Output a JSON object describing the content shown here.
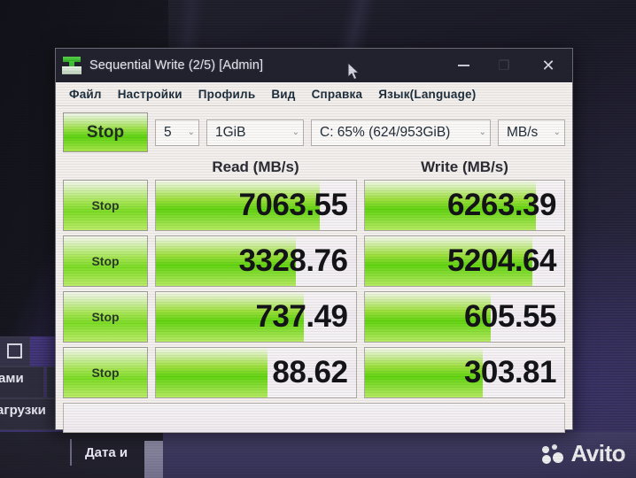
{
  "window": {
    "title": "Sequential Write (2/5) [Admin]",
    "app_icon": "crystaldiskmark-icon",
    "minimize_label": "–",
    "maximize_label": "❐",
    "close_label": "✕"
  },
  "menu": {
    "items": [
      {
        "label": "Файл"
      },
      {
        "label": "Настройки"
      },
      {
        "label": "Профиль"
      },
      {
        "label": "Вид"
      },
      {
        "label": "Справка"
      },
      {
        "label": "Язык(Language)"
      }
    ]
  },
  "toolbar": {
    "all_button_label": "Stop",
    "run_count": "5",
    "test_size": "1GiB",
    "drive": "C: 65% (624/953GiB)",
    "unit": "MB/s",
    "caret": "⌄"
  },
  "headers": {
    "read": "Read (MB/s)",
    "write": "Write (MB/s)"
  },
  "rows": [
    {
      "button_label": "Stop",
      "active": true,
      "read_value": "7063.55",
      "read_fill_pct": 82,
      "write_value": "6263.39",
      "write_fill_pct": 86
    },
    {
      "button_label": "Stop",
      "active": false,
      "read_value": "3328.76",
      "read_fill_pct": 70,
      "write_value": "5204.64",
      "write_fill_pct": 84
    },
    {
      "button_label": "Stop",
      "active": false,
      "read_value": "737.49",
      "read_fill_pct": 74,
      "write_value": "605.55",
      "write_fill_pct": 63
    },
    {
      "button_label": "Stop",
      "active": false,
      "read_value": "88.62",
      "read_fill_pct": 56,
      "write_value": "303.81",
      "write_fill_pct": 59
    }
  ],
  "status_bar": {
    "text": ""
  },
  "desktop": {
    "background_text_1": "ами",
    "background_text_2": "агрузки",
    "background_arrow": "◥"
  },
  "taskbar": {
    "date_label": "Дата и",
    "caret": "∧"
  },
  "watermark": {
    "text": "Avito"
  },
  "colors": {
    "accent_green": "#63d413",
    "title_bar": "#22222f",
    "window_face": "#f3efed",
    "active_marker_red": "#e8401c"
  }
}
